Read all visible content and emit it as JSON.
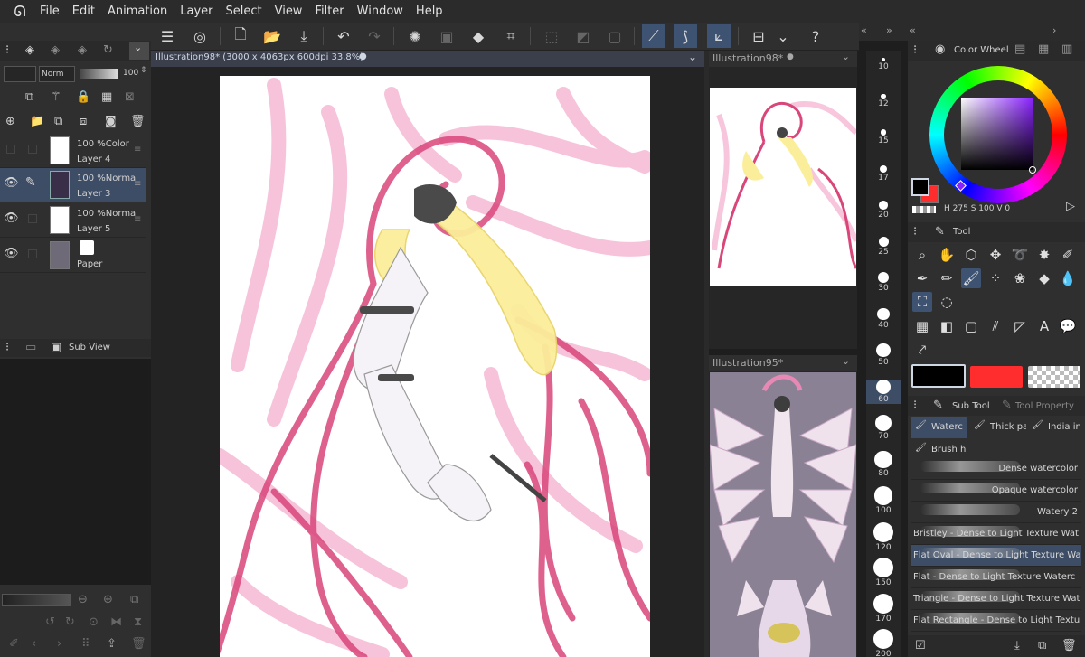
{
  "menu": [
    "File",
    "Edit",
    "Animation",
    "Layer",
    "Select",
    "View",
    "Filter",
    "Window",
    "Help"
  ],
  "document": {
    "tab_title": "Illustration98* (3000 x 4063px 600dpi 33.8%)"
  },
  "layer_panel": {
    "blend_mode": "Norm",
    "opacity": "100",
    "layers": [
      {
        "opacity": "100 %",
        "mode": "Color",
        "name": "Layer 4",
        "visible": false,
        "thumb": "#ffffff"
      },
      {
        "opacity": "100 %",
        "mode": "Norma",
        "name": "Layer 3",
        "visible": true,
        "thumb": "#3a2f48",
        "selected": true
      },
      {
        "opacity": "100 %",
        "mode": "Norma",
        "name": "Layer 5",
        "visible": true,
        "thumb": "#ffffff"
      },
      {
        "opacity": "",
        "mode": "",
        "name": "Paper",
        "visible": true,
        "thumb": "#6f6a78"
      }
    ]
  },
  "sub_view": {
    "label": "Sub View"
  },
  "navigators": [
    {
      "title": "Illustration98*"
    },
    {
      "title": "Illustration95*"
    }
  ],
  "brush_sizes": [
    "10",
    "12",
    "15",
    "17",
    "20",
    "25",
    "30",
    "40",
    "50",
    "60",
    "70",
    "80",
    "100",
    "120",
    "150",
    "170",
    "200"
  ],
  "color_panel": {
    "title": "Color Wheel",
    "readout_h": "275",
    "readout_s": "100",
    "readout_v": "0",
    "main_color": "#000000",
    "sub_color": "#ff2d2d"
  },
  "tool_panel": {
    "title": "Tool"
  },
  "subtool_panel": {
    "tab_subtool": "Sub Tool",
    "tab_property": "Tool Property",
    "groups": [
      "Waterc",
      "Thick pa",
      "India in",
      "Brush h"
    ],
    "items": [
      {
        "name": "Dense watercolor"
      },
      {
        "name": "Opaque watercolor"
      },
      {
        "name": "Watery 2"
      },
      {
        "name": "Bristley - Dense to Light Texture Wat"
      },
      {
        "name": "Flat Oval - Dense to Light Texture Wa",
        "selected": true
      },
      {
        "name": "Flat - Dense to Light Texture Waterc"
      },
      {
        "name": "Triangle - Dense to Light Texture Wat"
      },
      {
        "name": "Flat Rectangle - Dense to Light Textu"
      }
    ]
  }
}
